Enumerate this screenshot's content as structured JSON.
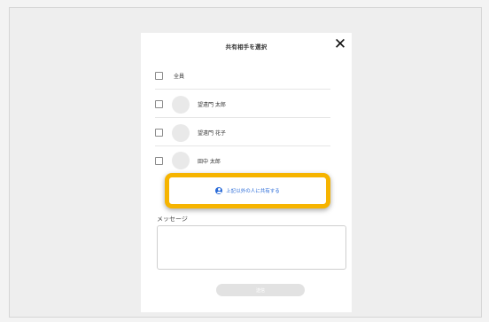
{
  "modal": {
    "title": "共有相手を選択",
    "close_symbol": "✕"
  },
  "recipients": [
    {
      "label": "全員",
      "type": "all",
      "checked": false
    },
    {
      "label": "望遠門 太郎",
      "type": "user",
      "checked": false
    },
    {
      "label": "望遠門 花子",
      "type": "user",
      "checked": false
    },
    {
      "label": "田中 太郎",
      "type": "user",
      "checked": false
    }
  ],
  "share_others": {
    "label": "上記以外の人に共有する",
    "icon": "person-icon",
    "highlight_color": "#f6b400",
    "text_color": "#2a6bd8"
  },
  "message": {
    "label": "メッセージ",
    "value": "",
    "placeholder": ""
  },
  "send_button": {
    "label": "送信",
    "enabled": false
  }
}
